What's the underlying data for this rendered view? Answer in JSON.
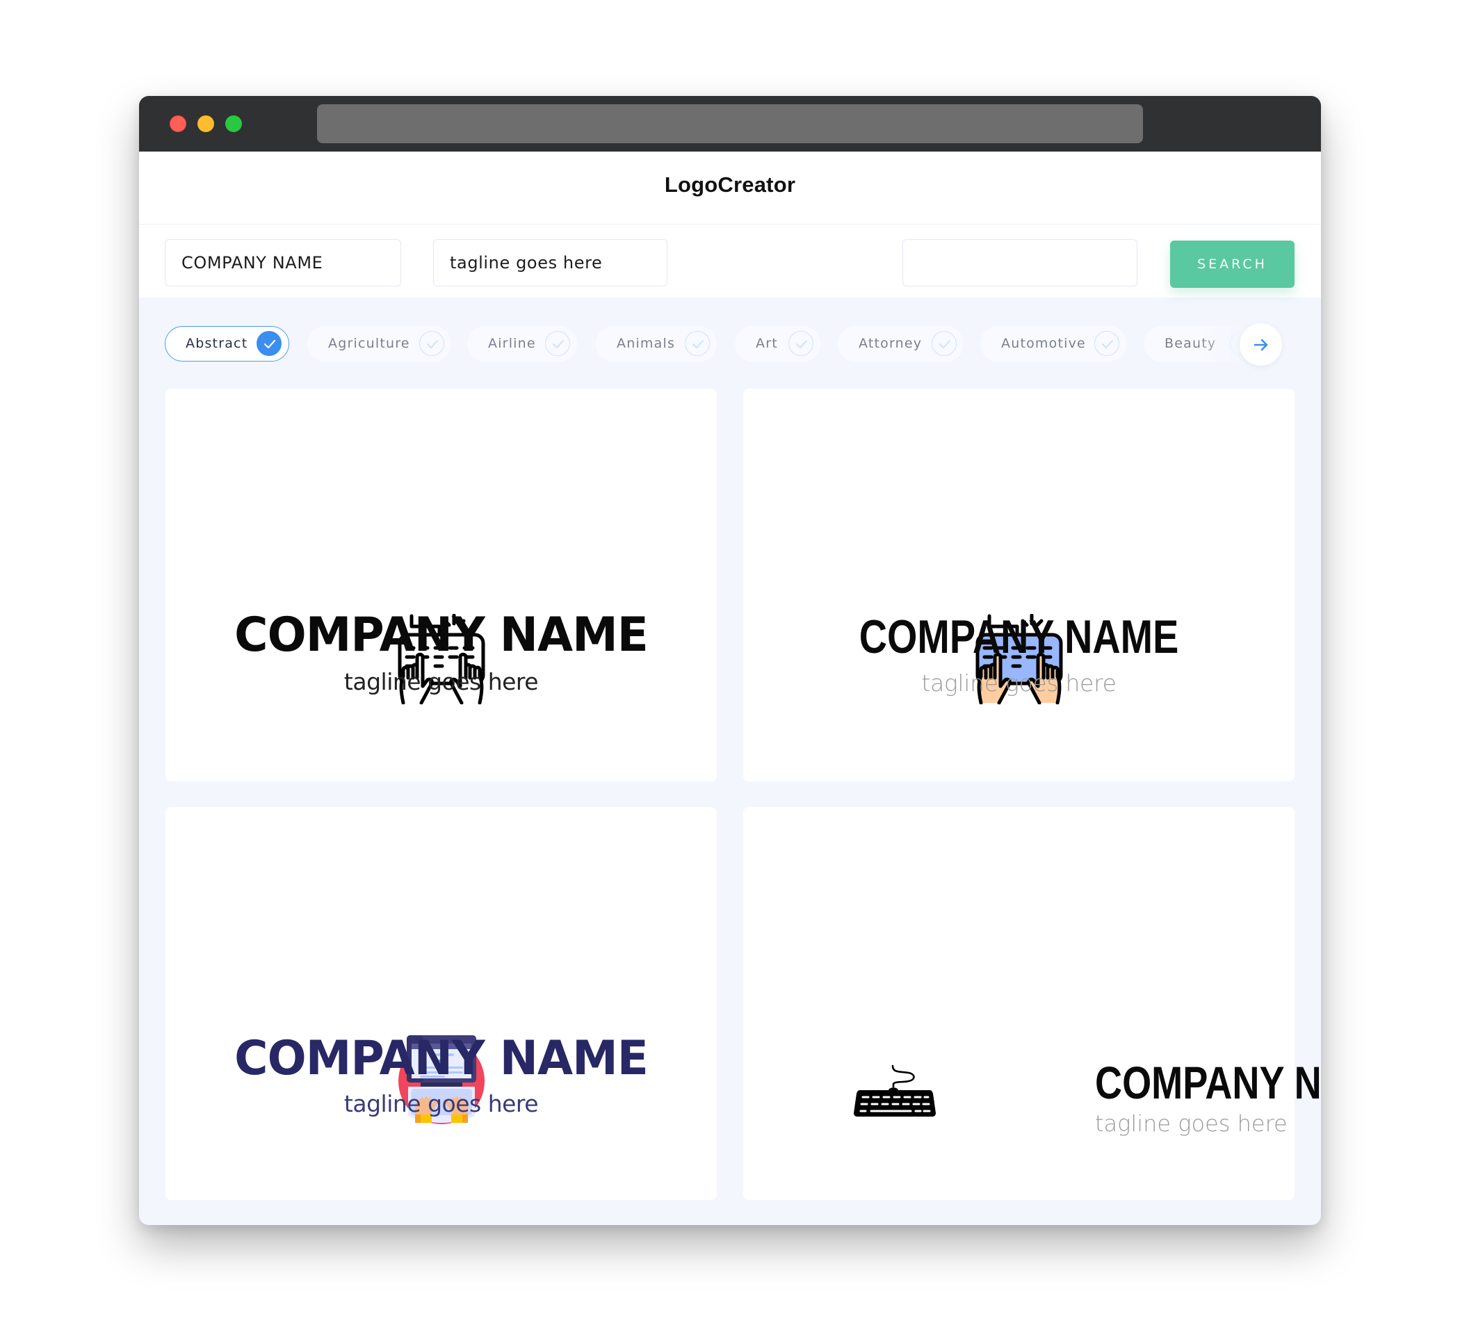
{
  "window": {
    "traffic_lights": [
      "close",
      "minimize",
      "maximize"
    ],
    "address_bar_text": ""
  },
  "header": {
    "brand": "LogoCreator"
  },
  "search": {
    "company_name_value": "COMPANY NAME",
    "tagline_value": "tagline goes here",
    "keyword_value": "",
    "keyword_placeholder": "",
    "search_label": "SEARCH",
    "colors": {
      "search_button": "#5ac8a0"
    }
  },
  "categories": {
    "items": [
      {
        "label": "Abstract",
        "selected": true
      },
      {
        "label": "Agriculture",
        "selected": false
      },
      {
        "label": "Airline",
        "selected": false
      },
      {
        "label": "Animals",
        "selected": false
      },
      {
        "label": "Art",
        "selected": false
      },
      {
        "label": "Attorney",
        "selected": false
      },
      {
        "label": "Automotive",
        "selected": false
      },
      {
        "label": "Beauty",
        "selected": false
      }
    ],
    "next_icon": "arrow-right-icon",
    "colors": {
      "selected_accent": "#3a8ef0"
    }
  },
  "logos": [
    {
      "icon": "keyboard-typing-hands-outline-icon",
      "company_name": "COMPANY NAME",
      "tagline": "tagline goes here",
      "name_color": "#0a0a0a",
      "tagline_color": "#222222"
    },
    {
      "icon": "keyboard-typing-hands-color-icon",
      "company_name": "COMPANY NAME",
      "tagline": "tagline goes here",
      "name_color": "#0a0a0a",
      "tagline_color": "#9a9a9a"
    },
    {
      "icon": "laptop-typing-circle-icon",
      "company_name": "COMPANY NAME",
      "tagline": "tagline goes here",
      "name_color": "#282866",
      "tagline_color": "#3a3a7a"
    },
    {
      "icon": "keyboard-cable-solid-icon",
      "company_name": "COMPANY NAME",
      "tagline": "tagline goes here",
      "name_color": "#0a0a0a",
      "tagline_color": "#9a9a9a"
    }
  ]
}
